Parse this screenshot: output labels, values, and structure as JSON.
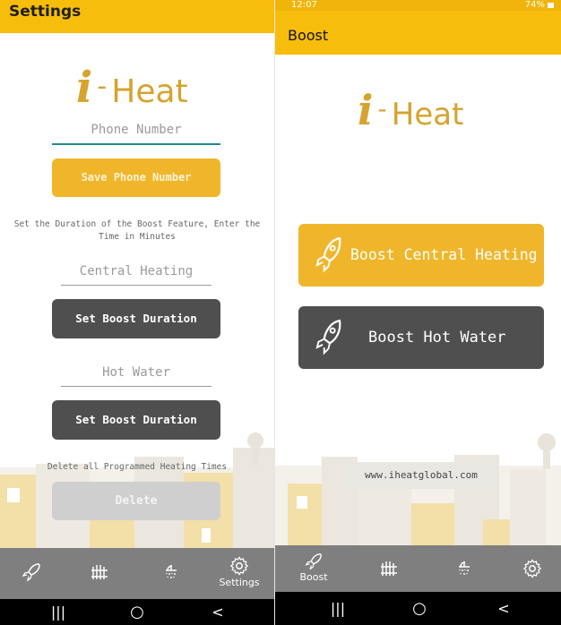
{
  "settings_screen": {
    "title": "Settings",
    "logo": {
      "i": "i",
      "dash": "-",
      "heat": "Heat"
    },
    "phone_placeholder": "Phone Number",
    "save_phone_button": "Save Phone Number",
    "boost_instructions": "Set the Duration of the Boost Feature, Enter the Time in Minutes",
    "central_heating_placeholder": "Central Heating",
    "set_boost_duration_1": "Set Boost Duration",
    "hot_water_placeholder": "Hot Water",
    "set_boost_duration_2": "Set Boost Duration",
    "delete_caption": "Delete all Programmed Heating Times",
    "delete_button": "Delete",
    "nav": {
      "boost_icon": "rocket-icon",
      "heating_icon": "radiator-icon",
      "hot_water_icon": "shower-icon",
      "settings_icon": "gear-icon",
      "settings_label": "Settings",
      "active": "settings"
    }
  },
  "boost_screen": {
    "status_time": "12:07",
    "status_battery": "74%",
    "title": "Boost",
    "logo": {
      "i": "i",
      "dash": "-",
      "heat": "Heat"
    },
    "boost_central_heating_button": "Boost Central Heating",
    "boost_hot_water_button": "Boost Hot Water",
    "website": "www.iheatglobal.com",
    "nav": {
      "boost_icon": "rocket-icon",
      "boost_label": "Boost",
      "heating_icon": "radiator-icon",
      "hot_water_icon": "shower-icon",
      "settings_icon": "gear-icon",
      "active": "boost"
    }
  },
  "system_nav": {
    "recent": "|||",
    "home": "○",
    "back": "<"
  },
  "colors": {
    "brand_yellow": "#f7bd0c",
    "button_yellow": "#f0b62b",
    "button_dark": "#4f4f4f",
    "logo_gold": "#d6a32f",
    "nav_grey": "#7f7f7f"
  }
}
